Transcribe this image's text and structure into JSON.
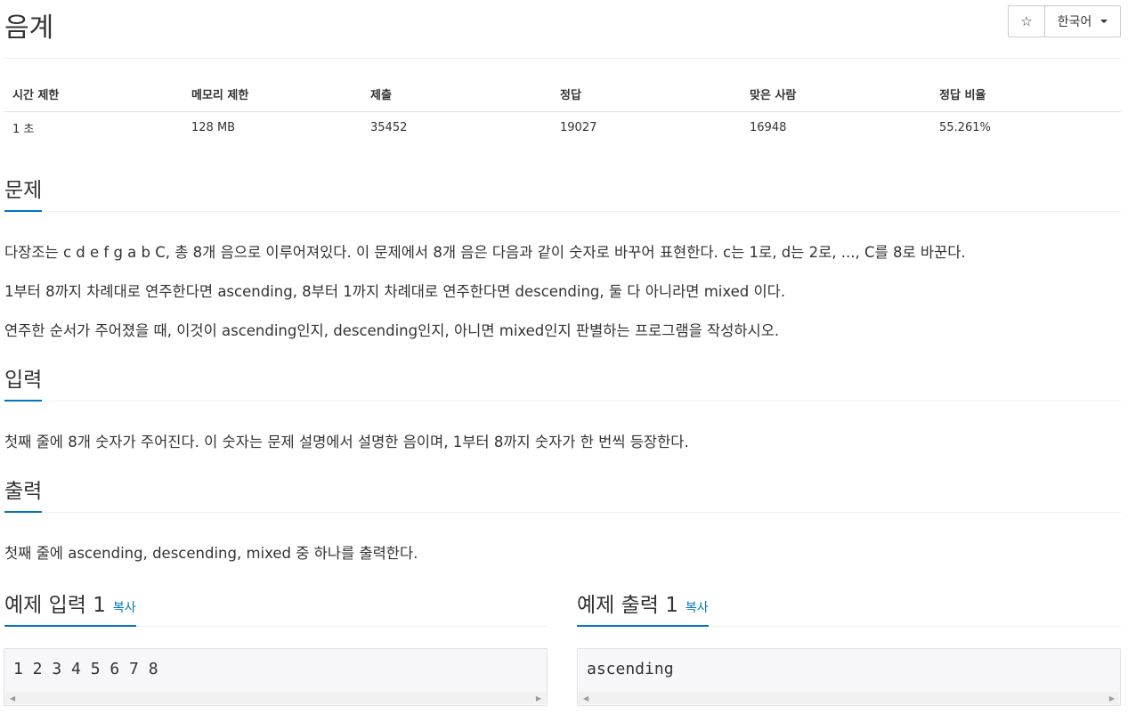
{
  "header": {
    "title": "음계",
    "star_icon": "☆",
    "language_label": "한국어"
  },
  "info": {
    "headers": [
      "시간 제한",
      "메모리 제한",
      "제출",
      "정답",
      "맞은 사람",
      "정답 비율"
    ],
    "values": [
      "1 초",
      "128 MB",
      "35452",
      "19027",
      "16948",
      "55.261%"
    ]
  },
  "problem": {
    "title": "문제",
    "paragraphs": [
      "다장조는 c d e f g a b C, 총 8개 음으로 이루어져있다. 이 문제에서 8개 음은 다음과 같이 숫자로 바꾸어 표현한다. c는 1로, d는 2로, ..., C를 8로 바꾼다.",
      "1부터 8까지 차례대로 연주한다면 ascending, 8부터 1까지 차례대로 연주한다면 descending, 둘 다 아니라면 mixed 이다.",
      "연주한 순서가 주어졌을 때, 이것이 ascending인지, descending인지, 아니면 mixed인지 판별하는 프로그램을 작성하시오."
    ]
  },
  "input": {
    "title": "입력",
    "text": "첫째 줄에 8개 숫자가 주어진다. 이 숫자는 문제 설명에서 설명한 음이며, 1부터 8까지 숫자가 한 번씩 등장한다."
  },
  "output": {
    "title": "출력",
    "text": "첫째 줄에 ascending, descending, mixed 중 하나를 출력한다."
  },
  "samples": {
    "input_title": "예제 입력 1",
    "output_title": "예제 출력 1",
    "copy_label": "복사",
    "input_value": "1 2 3 4 5 6 7 8",
    "output_value": "ascending"
  },
  "icons": {
    "scroll_left": "◀",
    "scroll_right": "▶"
  },
  "colors": {
    "accent": "#0076c0",
    "sample_bg": "#f7f7f9"
  }
}
